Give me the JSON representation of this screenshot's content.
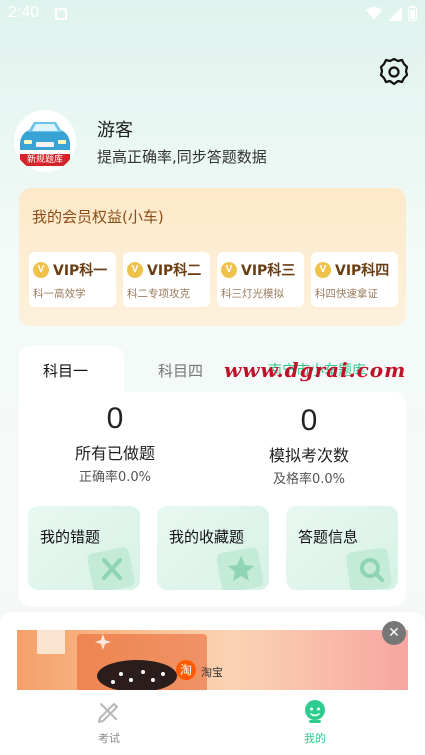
{
  "status_bar": {
    "time": "2:40"
  },
  "profile": {
    "username": "游客",
    "subtitle": "提高正确率,同步答题数据",
    "avatar_badge": "新规题库"
  },
  "vip": {
    "title": "我的会员权益(小车)",
    "badge_glyph": "V",
    "items": [
      {
        "label": "VIP科一",
        "sub": "科一高效学"
      },
      {
        "label": "VIP科二",
        "sub": "科二专项攻克"
      },
      {
        "label": "VIP科三",
        "sub": "科三灯光模拟"
      },
      {
        "label": "VIP科四",
        "sub": "科四快速拿证"
      }
    ]
  },
  "stats": {
    "tabs": [
      {
        "label": "科目一"
      },
      {
        "label": "科目四"
      }
    ],
    "link": "南宁市小车题库 ›",
    "watermark": "www.dgrai.com",
    "done": {
      "value": "0",
      "label": "所有已做题",
      "rate": "正确率0.0%"
    },
    "mock": {
      "value": "0",
      "label": "模拟考次数",
      "rate": "及格率0.0%"
    },
    "features": [
      {
        "label": "我的错题"
      },
      {
        "label": "我的收藏题"
      },
      {
        "label": "答题信息"
      }
    ]
  },
  "ad": {
    "brand": "淘宝",
    "logo_glyph": "淘",
    "close_glyph": "✕"
  },
  "bottom_nav": [
    {
      "label": "考试",
      "active": false
    },
    {
      "label": "我的",
      "active": true
    }
  ],
  "colors": {
    "accent": "#2ecc8f",
    "vip_text": "#8a4d1a",
    "watermark": "#c0102a"
  }
}
